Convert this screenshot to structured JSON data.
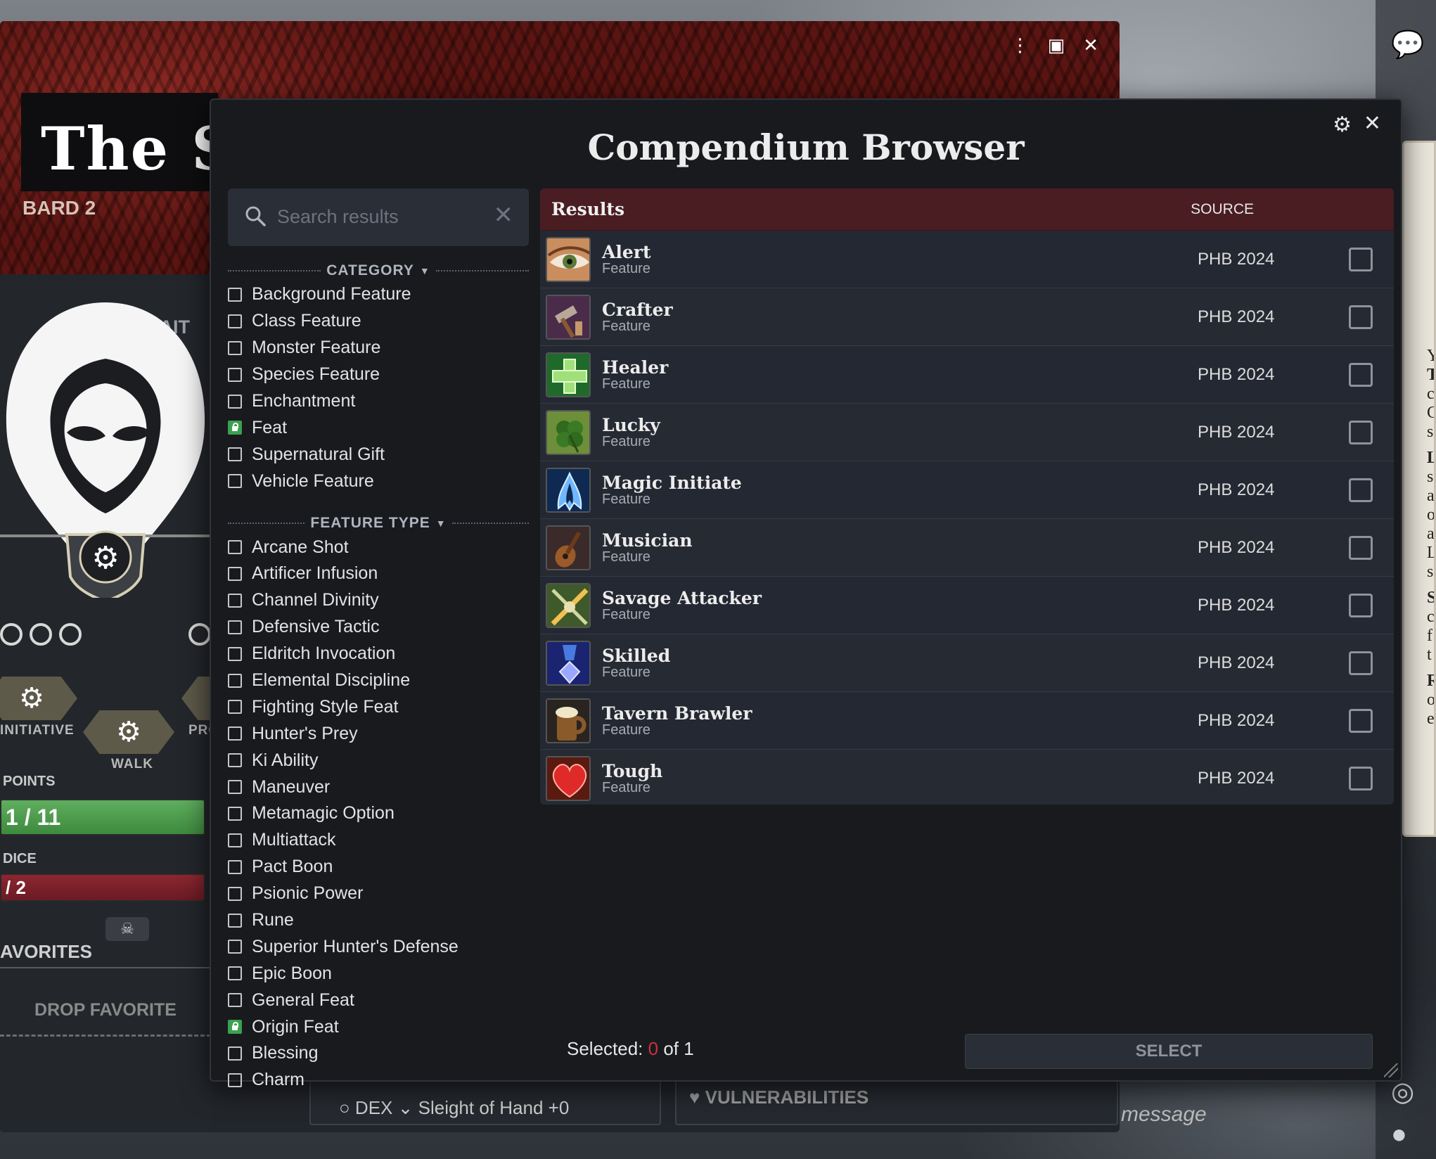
{
  "background_sheet": {
    "title": "The Sha",
    "class_level": "Bard 2",
    "portrait_toggle": "Portrait",
    "initiative_label": "Initiative",
    "walk_label": "Walk",
    "pro_label": "Pro",
    "points_label": "Points",
    "hp_value": "1 / 11",
    "dice_label": "Dice",
    "hit_dice_value": "/ 2",
    "favorites_label": "Avorites",
    "drop_favorite": "Drop Favorite",
    "skill_row": "○  DEX  ⌄  Sleight of Hand   +0",
    "vulnerabilities_label": "Vulnerabilities",
    "chat_placeholder": "message",
    "parchment_snippets": [
      "Y",
      "T",
      "c",
      "C",
      "s",
      "L",
      "s",
      "a",
      "o",
      "a",
      "L",
      "s",
      "S",
      "c",
      "f",
      "t",
      "R",
      "o",
      "e"
    ]
  },
  "dialog": {
    "title": "Compendium Browser",
    "search": {
      "placeholder": "Search results",
      "value": ""
    },
    "filters": {
      "category": {
        "label": "Category",
        "items": [
          {
            "label": "Background Feature",
            "state": "unchecked"
          },
          {
            "label": "Class Feature",
            "state": "unchecked"
          },
          {
            "label": "Monster Feature",
            "state": "unchecked"
          },
          {
            "label": "Species Feature",
            "state": "unchecked"
          },
          {
            "label": "Enchantment",
            "state": "unchecked"
          },
          {
            "label": "Feat",
            "state": "locked"
          },
          {
            "label": "Supernatural Gift",
            "state": "unchecked"
          },
          {
            "label": "Vehicle Feature",
            "state": "unchecked"
          }
        ]
      },
      "feature_type": {
        "label": "Feature Type",
        "items": [
          {
            "label": "Arcane Shot",
            "state": "unchecked"
          },
          {
            "label": "Artificer Infusion",
            "state": "unchecked"
          },
          {
            "label": "Channel Divinity",
            "state": "unchecked"
          },
          {
            "label": "Defensive Tactic",
            "state": "unchecked"
          },
          {
            "label": "Eldritch Invocation",
            "state": "unchecked"
          },
          {
            "label": "Elemental Discipline",
            "state": "unchecked"
          },
          {
            "label": "Fighting Style Feat",
            "state": "unchecked"
          },
          {
            "label": "Hunter's Prey",
            "state": "unchecked"
          },
          {
            "label": "Ki Ability",
            "state": "unchecked"
          },
          {
            "label": "Maneuver",
            "state": "unchecked"
          },
          {
            "label": "Metamagic Option",
            "state": "unchecked"
          },
          {
            "label": "Multiattack",
            "state": "unchecked"
          },
          {
            "label": "Pact Boon",
            "state": "unchecked"
          },
          {
            "label": "Psionic Power",
            "state": "unchecked"
          },
          {
            "label": "Rune",
            "state": "unchecked"
          },
          {
            "label": "Superior Hunter's Defense",
            "state": "unchecked"
          },
          {
            "label": "Epic Boon",
            "state": "unchecked"
          },
          {
            "label": "General Feat",
            "state": "unchecked"
          },
          {
            "label": "Origin Feat",
            "state": "locked"
          },
          {
            "label": "Blessing",
            "state": "unchecked"
          },
          {
            "label": "Charm",
            "state": "unchecked"
          }
        ]
      }
    },
    "results": {
      "title": "Results",
      "source_header": "Source",
      "rows": [
        {
          "name": "Alert",
          "type": "Feature",
          "source": "PHB 2024",
          "icon": "eye-icon"
        },
        {
          "name": "Crafter",
          "type": "Feature",
          "source": "PHB 2024",
          "icon": "hammer-icon"
        },
        {
          "name": "Healer",
          "type": "Feature",
          "source": "PHB 2024",
          "icon": "green-cross-icon"
        },
        {
          "name": "Lucky",
          "type": "Feature",
          "source": "PHB 2024",
          "icon": "four-leaf-clover-icon"
        },
        {
          "name": "Magic Initiate",
          "type": "Feature",
          "source": "PHB 2024",
          "icon": "arcane-flame-icon"
        },
        {
          "name": "Musician",
          "type": "Feature",
          "source": "PHB 2024",
          "icon": "lute-icon"
        },
        {
          "name": "Savage Attacker",
          "type": "Feature",
          "source": "PHB 2024",
          "icon": "crossed-weapons-icon"
        },
        {
          "name": "Skilled",
          "type": "Feature",
          "source": "PHB 2024",
          "icon": "medal-icon"
        },
        {
          "name": "Tavern Brawler",
          "type": "Feature",
          "source": "PHB 2024",
          "icon": "tankard-icon"
        },
        {
          "name": "Tough",
          "type": "Feature",
          "source": "PHB 2024",
          "icon": "heart-icon"
        }
      ]
    },
    "footer": {
      "selected_prefix": "Selected:",
      "selected_count": "0",
      "selected_suffix": "of 1",
      "select_button": "Select"
    }
  },
  "colors": {
    "dialog_bg": "#181a1e",
    "results_header": "#4a1d22",
    "locked_checkbox": "#3aa150",
    "selected_count_zero": "#c8323c",
    "hp_bar": "#4f9d4f",
    "hit_dice_bar": "#7a2029"
  }
}
